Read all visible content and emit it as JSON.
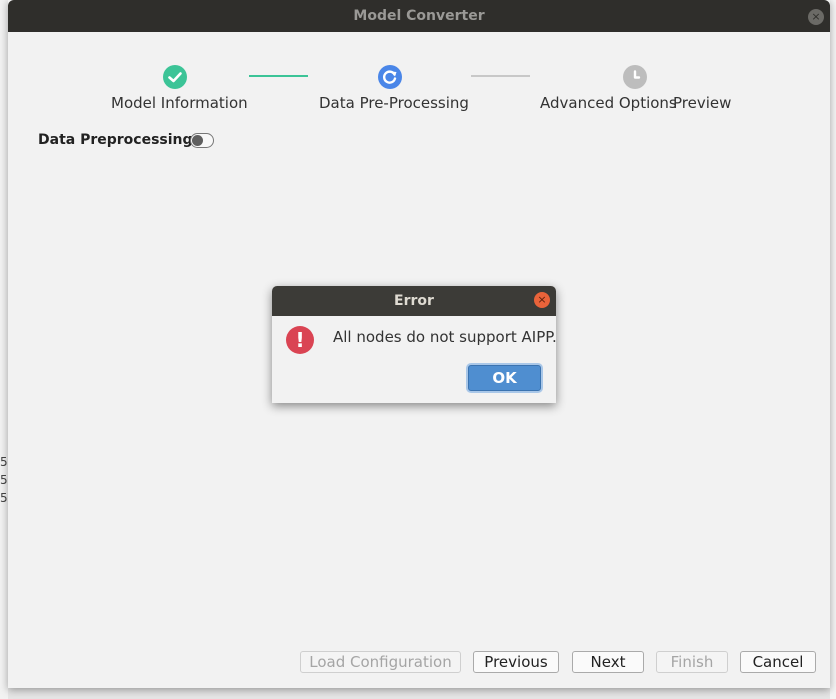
{
  "window": {
    "title": "Model Converter",
    "close_glyph": "×"
  },
  "steps": [
    {
      "label": "Model Information",
      "state": "complete",
      "icon": "check-circle-icon",
      "color": "#3cc497"
    },
    {
      "label": "Data Pre-Processing",
      "state": "active",
      "icon": "refresh-circle-icon",
      "color": "#4a86e8"
    },
    {
      "label": "Advanced Options",
      "state": "pending",
      "icon": "clock-circle-icon",
      "color": "#bdbdbd"
    },
    {
      "label": "Preview",
      "state": "pending"
    }
  ],
  "connector_colors": {
    "done": "#3cc497",
    "todo": "#c8c8c8"
  },
  "data_preprocessing": {
    "label": "Data Preprocessing",
    "toggle_on": false
  },
  "background_fragments": [
    "5",
    "5",
    "5"
  ],
  "buttons": {
    "load_configuration": "Load Configuration",
    "previous": "Previous",
    "next": "Next",
    "finish": "Finish",
    "cancel": "Cancel"
  },
  "dialog": {
    "title": "Error",
    "close_glyph": "×",
    "icon_glyph": "!",
    "message": "All nodes do not support AIPP.",
    "ok": "OK"
  }
}
